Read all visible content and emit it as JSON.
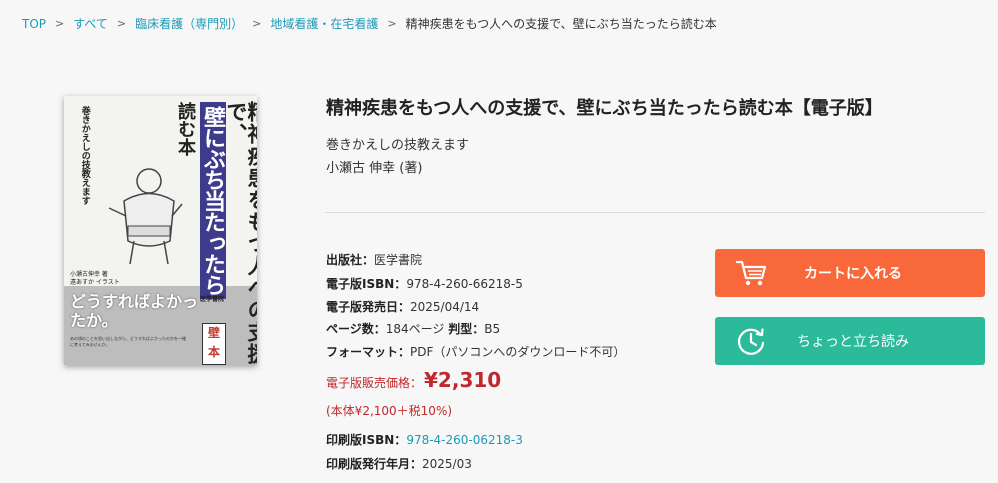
{
  "breadcrumb": {
    "items": [
      "TOP",
      "すべて",
      "臨床看護（専門別）",
      "地域看護・在宅看護"
    ],
    "current": "精神疾患をもつ人への支援で、壁にぶち当たったら読む本",
    "separator": ">"
  },
  "cover": {
    "title_col1": "精神疾患をもつ人への支援で、",
    "title_col2": "壁にぶち当たったら",
    "title_col3": "読む本",
    "subtitle": "巻きかえしの技教えます",
    "catch": "どうすればよかったか。",
    "author": "小瀬古伸幸 著",
    "illustrator": "遠あすか イラスト",
    "publisher": "医学書院",
    "stamp": "壁本",
    "blurb": "あの頃のことを思い出しながら、どうすればよかったのかを一緒に考えてみませんか。"
  },
  "product": {
    "title": "精神疾患をもつ人への支援で、壁にぶち当たったら読む本【電子版】",
    "subtitle": "巻きかえしの技教えます",
    "author": "小瀬古 伸幸 (著)"
  },
  "details": {
    "publisher_label": "出版社：",
    "publisher": "医学書院",
    "ebook_isbn_label": "電子版ISBN：",
    "ebook_isbn": "978-4-260-66218-5",
    "ebook_date_label": "電子版発売日：",
    "ebook_date": "2025/04/14",
    "pages_label": "ページ数：",
    "pages": "184ページ",
    "format_size_label": "判型：",
    "format_size": "B5",
    "format_label": "フォーマット：",
    "format": "PDF（パソコンへのダウンロード不可）",
    "price_label": "電子版販売価格：",
    "price": "¥2,310",
    "tax": "(本体¥2,100＋税10%)",
    "print_isbn_label": "印刷版ISBN：",
    "print_isbn": "978-4-260-06218-3",
    "print_date_label": "印刷版発行年月：",
    "print_date": "2025/03"
  },
  "buttons": {
    "cart": "カートに入れる",
    "preview": "ちょっと立ち読み",
    "cart_icon": "cart-icon",
    "preview_icon": "clock-icon"
  },
  "colors": {
    "accent_link": "#1a9ab8",
    "cart_button": "#f8683a",
    "preview_button": "#2bbb9a",
    "price": "#c1272d"
  }
}
